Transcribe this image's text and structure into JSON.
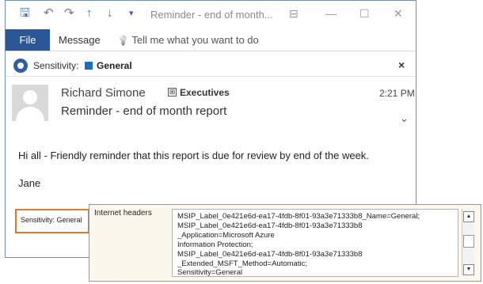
{
  "window": {
    "title": "Reminder - end of month...",
    "icons": {
      "save": "save-icon",
      "undo": "undo-icon",
      "redo": "redo-icon",
      "up": "arrow-up-icon",
      "down": "arrow-down-icon",
      "more": "more-icon",
      "ribbon_display": "ribbon-display-icon",
      "minimize": "minimize-icon",
      "maximize": "maximize-icon",
      "close": "close-icon"
    },
    "glyphs": {
      "save": "🖫",
      "undo": "↶",
      "redo": "↷",
      "up": "↑",
      "down": "↓",
      "more": "▾",
      "ribbon_display": "⊟",
      "minimize": "—",
      "maximize": "☐",
      "close": "✕"
    }
  },
  "ribbon": {
    "file_label": "File",
    "message_label": "Message",
    "tell_me_placeholder": "Tell me what you want to do",
    "tell_me_icon": "💡"
  },
  "sensitivity_bar": {
    "label": "Sensitivity:",
    "value": "General",
    "close_glyph": "×",
    "colors": {
      "icon": "#2f5ea6",
      "tag": "#1e6bc3"
    }
  },
  "message": {
    "sender": "Richard Simone",
    "group_icon": "⊞",
    "group": "Executives",
    "time": "2:21 PM",
    "subject": "Reminder - end of month report",
    "expand_glyph": "⌄",
    "body_line1": "Hi all - Friendly reminder that this report is due for review by end of the week.",
    "body_line2": "Jane",
    "footer_sensitivity": "Sensitivity: General"
  },
  "internet_headers": {
    "label": "Internet headers",
    "lines": [
      "MSIP_Label_0e421e6d-ea17-4fdb-8f01-93a3e71333b8_Name=General;",
      "MSIP_Label_0e421e6d-ea17-4fdb-8f01-93a3e71333b8",
      "_Application=Microsoft Azure",
      "Information Protection;",
      "MSIP_Label_0e421e6d-ea17-4fdb-8f01-93a3e71333b8",
      "_Extended_MSFT_Method=Automatic;",
      "Sensitivity=General"
    ],
    "scroll_up_glyph": "▲",
    "scroll_down_glyph": "▼"
  },
  "colors": {
    "accent": "#2b5797",
    "highlight_border": "#e07a2a",
    "header_bg": "#fbf7ec"
  }
}
